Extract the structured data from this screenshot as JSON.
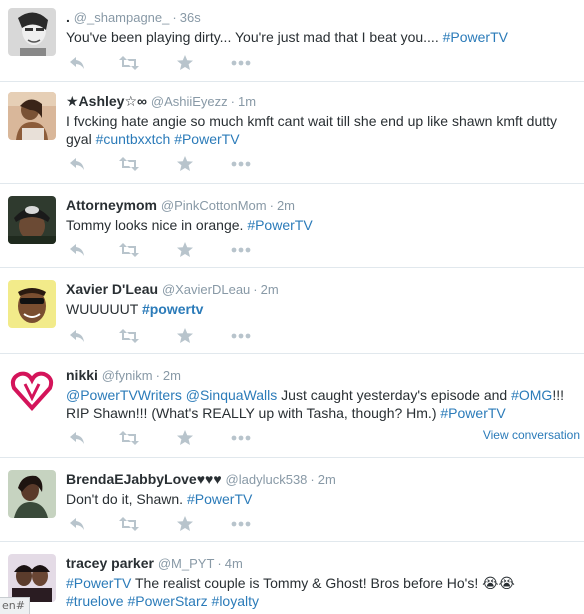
{
  "colors": {
    "link": "#2b7bb9",
    "meta": "#8899a6",
    "icon": "#b8c4cc",
    "text": "#292f33",
    "divider": "#e1e8ed"
  },
  "action_icons": [
    "reply-icon",
    "retweet-icon",
    "favorite-icon",
    "more-icon"
  ],
  "tweets": [
    {
      "fullname": ".",
      "username": "@_shampagne_",
      "time": "36s",
      "text_plain": "You've been playing dirty... You're just mad that I beat you.... ",
      "hashtag1": "#PowerTV"
    },
    {
      "fullname": "★Ashley☆∞",
      "username": "@AshiiEyezz",
      "time": "1m",
      "text_plain": "I fvcking hate angie so much kmft cant wait till she end up like shawn kmft dutty gyal ",
      "hashtag1": "#cuntbxxtch",
      "hashtag2": "#PowerTV"
    },
    {
      "fullname": "Attorneymom",
      "username": "@PinkCottonMom",
      "time": "2m",
      "text_plain": "Tommy looks nice in orange.  ",
      "hashtag1": "#PowerTV"
    },
    {
      "fullname": "Xavier D'Leau",
      "username": "@XavierDLeau",
      "time": "2m",
      "text_plain": "WUUUUUT ",
      "hashtag1": "#powertv"
    },
    {
      "fullname": "nikki",
      "username": "@fynikm",
      "time": "2m",
      "mention1": "@PowerTVWriters",
      "mention2": "@SinquaWalls",
      "text_part1": " Just caught yesterday's episode and ",
      "hashtag1": "#OMG",
      "text_part2": "!!! RIP Shawn!!! (What's REALLY up with Tasha, though? Hm.) ",
      "hashtag2": "#PowerTV",
      "view_conversation": "View conversation"
    },
    {
      "fullname": "BrendaEJabbyLove♥♥♥",
      "username": "@ladyluck538",
      "time": "2m",
      "text_plain": "Don't do it, Shawn. ",
      "hashtag1": "#PowerTV"
    },
    {
      "fullname": "tracey parker",
      "username": "@M_PYT",
      "time": "4m",
      "hashtag1": "#PowerTV",
      "text_plain": " The realist couple is Tommy & Ghost! Bros before Ho's! 😭😭",
      "hashtag2": "#truelove",
      "hashtag3": "#PowerStarz",
      "hashtag4": "#loyalty"
    }
  ],
  "status_bar": "en#"
}
